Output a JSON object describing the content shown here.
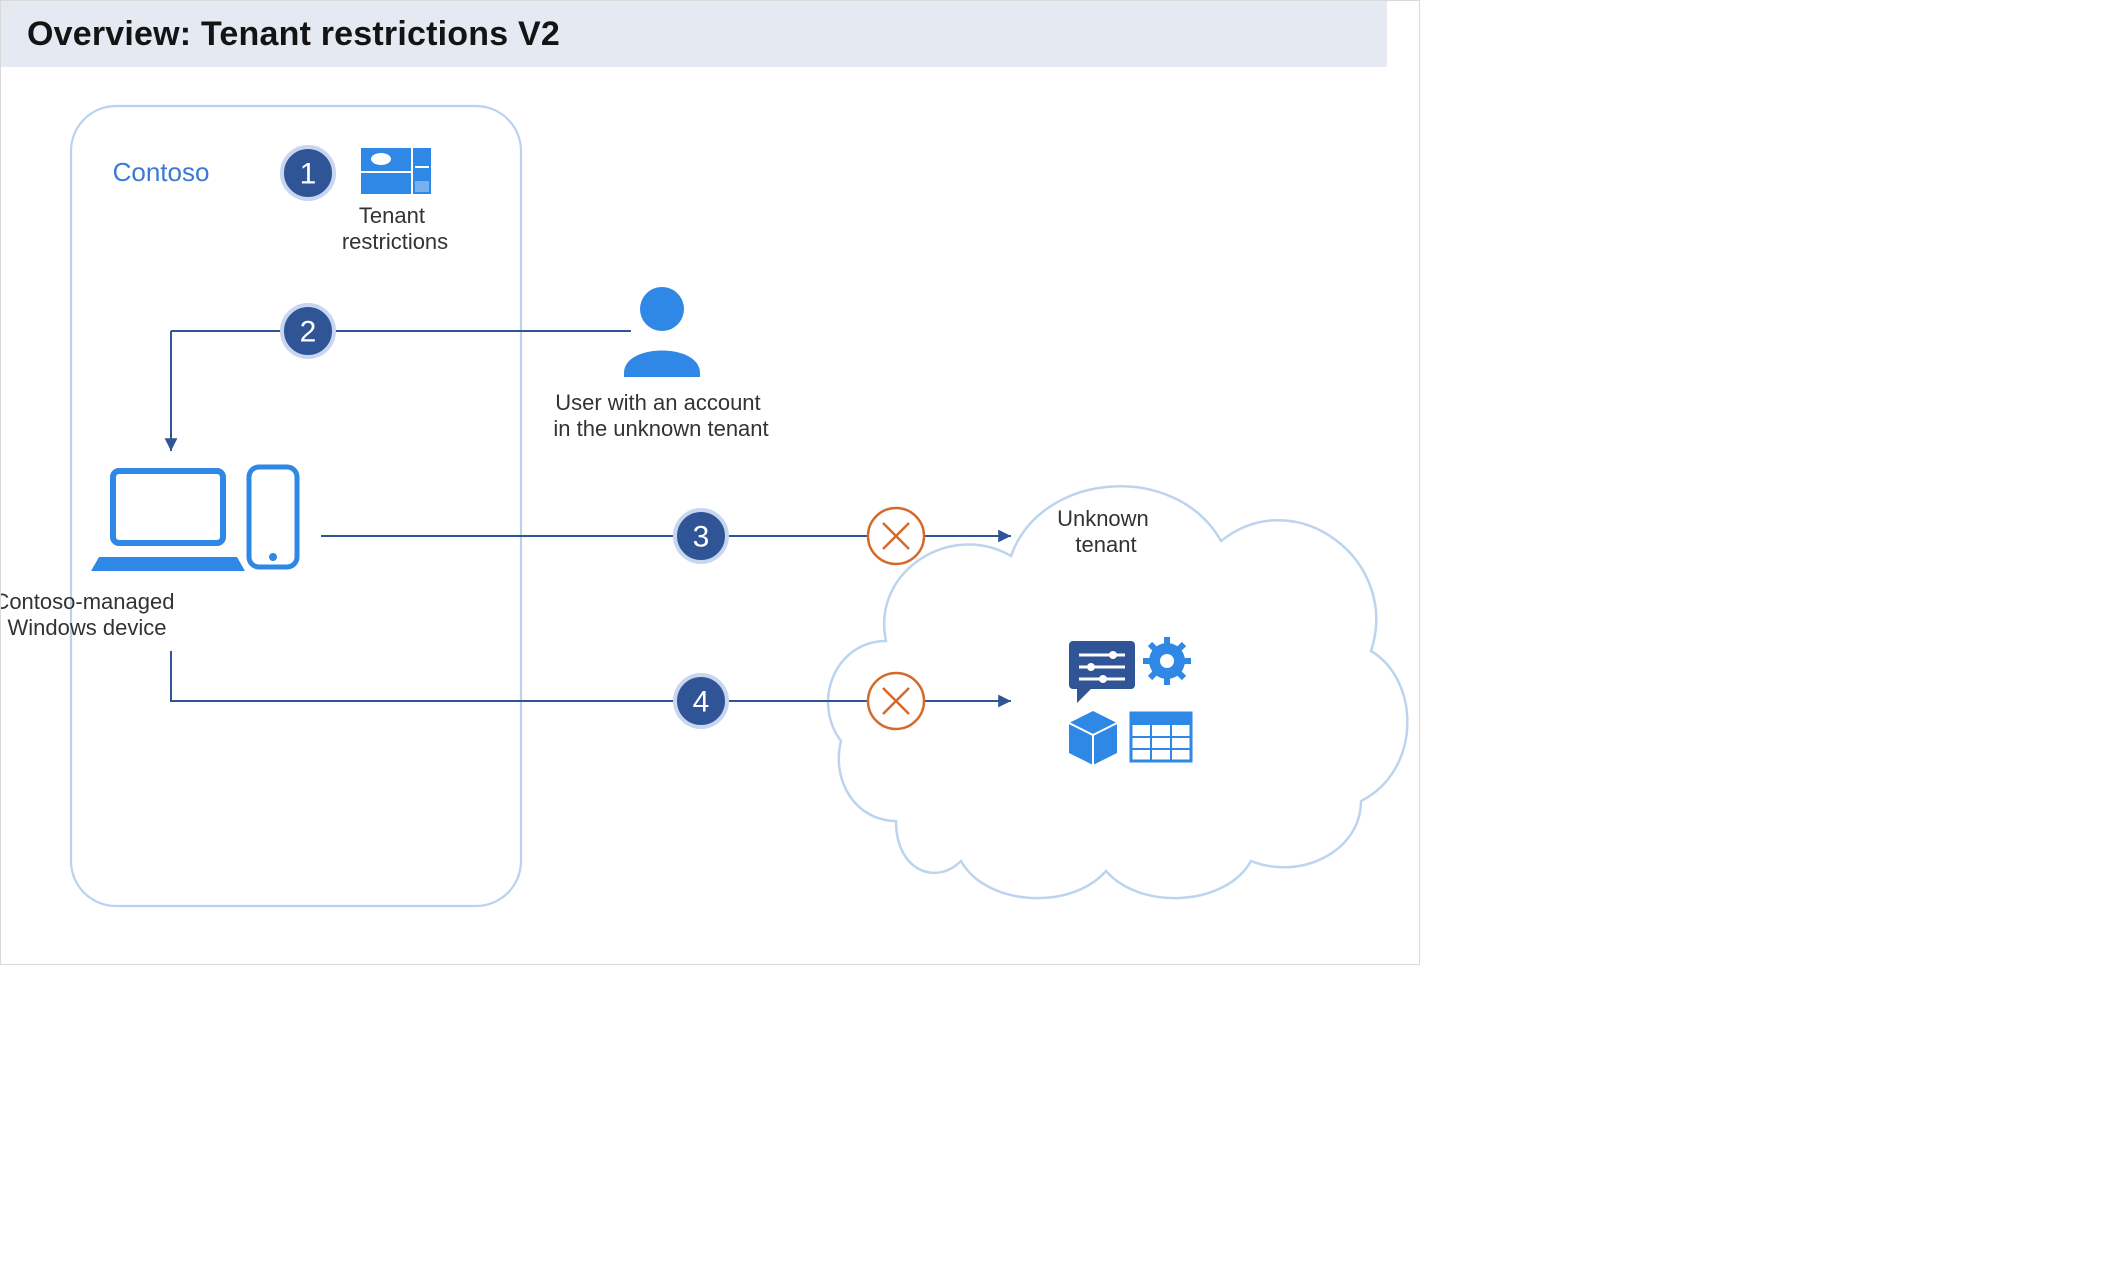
{
  "title": "Overview: Tenant restrictions V2",
  "tenant_name": "Contoso",
  "step1": {
    "number": "1",
    "caption": "Tenant\nrestrictions"
  },
  "step2": {
    "number": "2"
  },
  "device_caption": "Contoso-managed\nWindows device",
  "user_caption": "User with an account\nin the unknown tenant",
  "step3": {
    "number": "3"
  },
  "step4": {
    "number": "4"
  },
  "unknown_tenant_caption": "Unknown\ntenant",
  "colors": {
    "ms_blue": "#2f87e6",
    "step_fill": "#2f5597",
    "step_stroke": "#c8d6ef",
    "arrow": "#2f5597",
    "deny": "#d46a2a",
    "tenant_border": "#b9d2f2",
    "cloud_border": "#bcd4ef",
    "header_bg": "#e4e9f2"
  }
}
